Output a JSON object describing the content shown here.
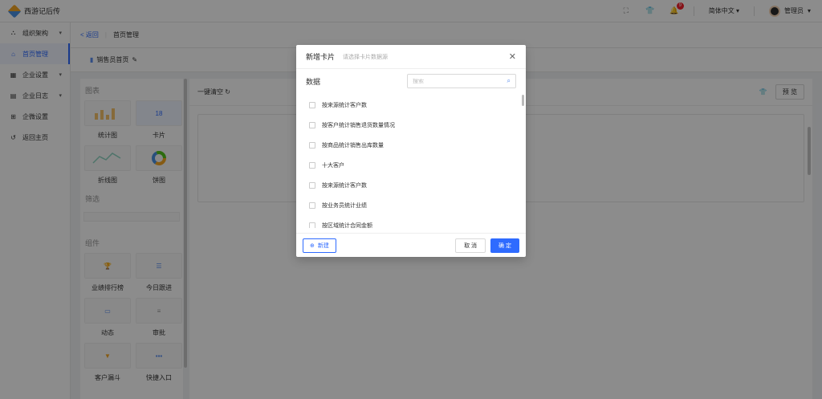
{
  "app": {
    "title": "西游记后传"
  },
  "topbar": {
    "language": "简体中文",
    "user": "管理员",
    "notification_count": "9"
  },
  "sidebar": {
    "items": [
      {
        "label": "组织架构",
        "icon": "org-icon"
      },
      {
        "label": "首页管理",
        "icon": "home-icon"
      },
      {
        "label": "企业设置",
        "icon": "settings-icon"
      },
      {
        "label": "企业日志",
        "icon": "log-icon"
      },
      {
        "label": "企微设置",
        "icon": "wecom-icon"
      },
      {
        "label": "返回主页",
        "icon": "return-icon"
      }
    ]
  },
  "breadcrumb": {
    "back": "返回",
    "current": "首页管理"
  },
  "subhead": {
    "page_name": "销售员首页"
  },
  "panel": {
    "charts_title": "图表",
    "charts": [
      {
        "label": "统计图"
      },
      {
        "label": "卡片"
      },
      {
        "label": "折线图"
      },
      {
        "label": "饼图"
      }
    ],
    "card_thumb_text": "18",
    "filter_title": "筛选",
    "components_title": "组件",
    "components": [
      {
        "label": "业绩排行榜"
      },
      {
        "label": "今日跟进"
      },
      {
        "label": "动态"
      },
      {
        "label": "审批"
      },
      {
        "label": "客户漏斗"
      },
      {
        "label": "快捷入口"
      }
    ]
  },
  "main": {
    "clear_label": "一键清空",
    "preview_label": "预 览"
  },
  "modal": {
    "title": "新增卡片",
    "subtitle": "请选择卡片数据源",
    "data_label": "数据",
    "search_placeholder": "搜索",
    "items": [
      "按来源统计客户数",
      "按客户统计销售退货数量情况",
      "按商品统计销售出库数量",
      "十大客户",
      "按来源统计客户数",
      "按业务员统计业绩",
      "按区域统计合同金额"
    ],
    "new_label": "新建",
    "cancel_label": "取 消",
    "ok_label": "确 定"
  }
}
